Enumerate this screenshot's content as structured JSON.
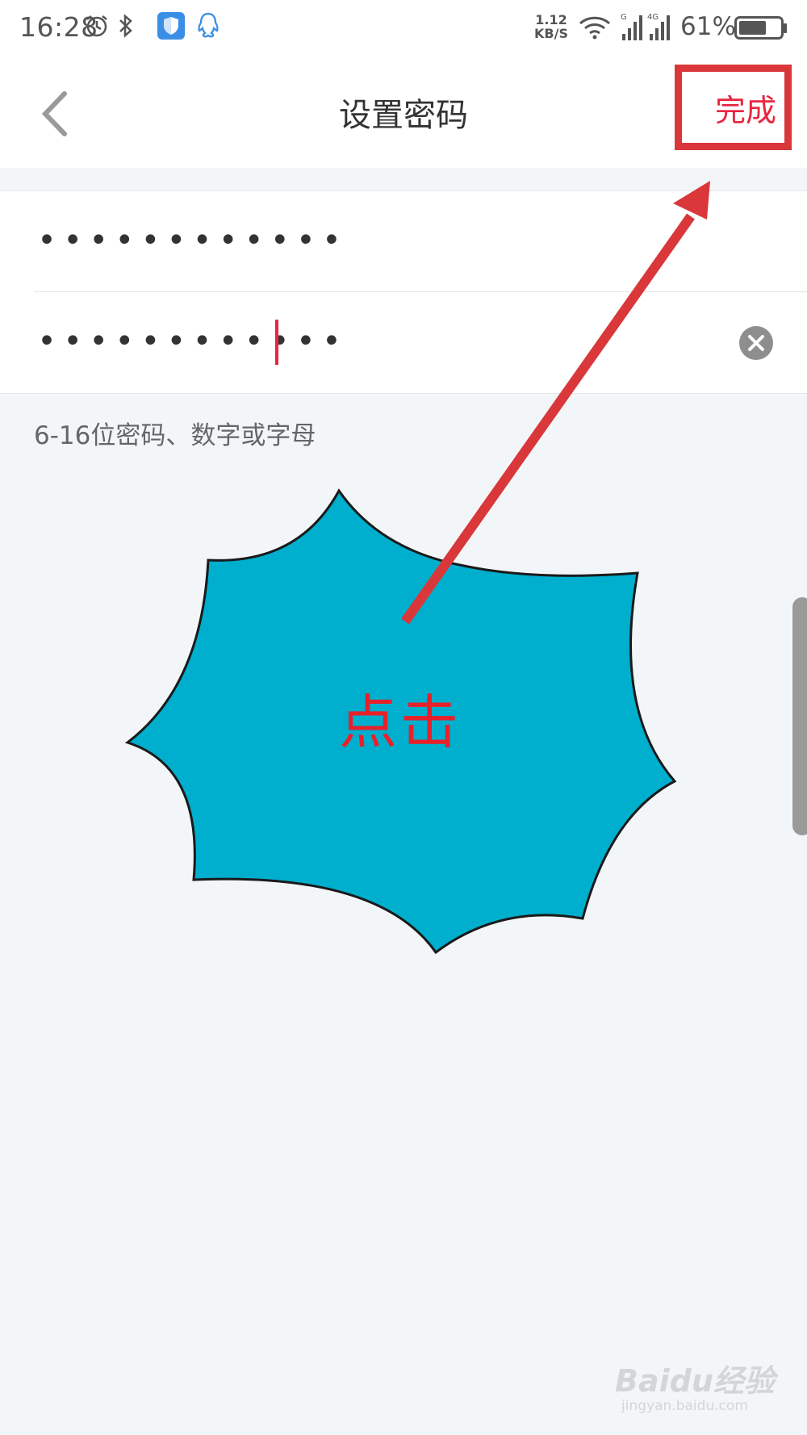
{
  "status_bar": {
    "time": "16:28",
    "net_speed_value": "1.12",
    "net_speed_unit": "KB/S",
    "signal_label_1": "G",
    "signal_label_2": "4G",
    "battery_percent": "61%",
    "icons": [
      "alarm-icon",
      "bluetooth-icon",
      "security-shield-icon",
      "qq-icon",
      "wifi-icon",
      "signal-icon",
      "battery-icon"
    ]
  },
  "header": {
    "title": "设置密码",
    "done_label": "完成"
  },
  "form": {
    "password_mask": "••••••••••••",
    "confirm_mask": "••••••••••••"
  },
  "hint": "6-16位密码、数字或字母",
  "annotation": {
    "burst_label": "点击",
    "highlight_color": "#d9373a",
    "burst_color": "#00aecd"
  },
  "watermark": {
    "logo": "Baidu经验",
    "sub": "jingyan.baidu.com"
  },
  "colors": {
    "accent": "#e8253f",
    "background": "#f3f6f9"
  }
}
